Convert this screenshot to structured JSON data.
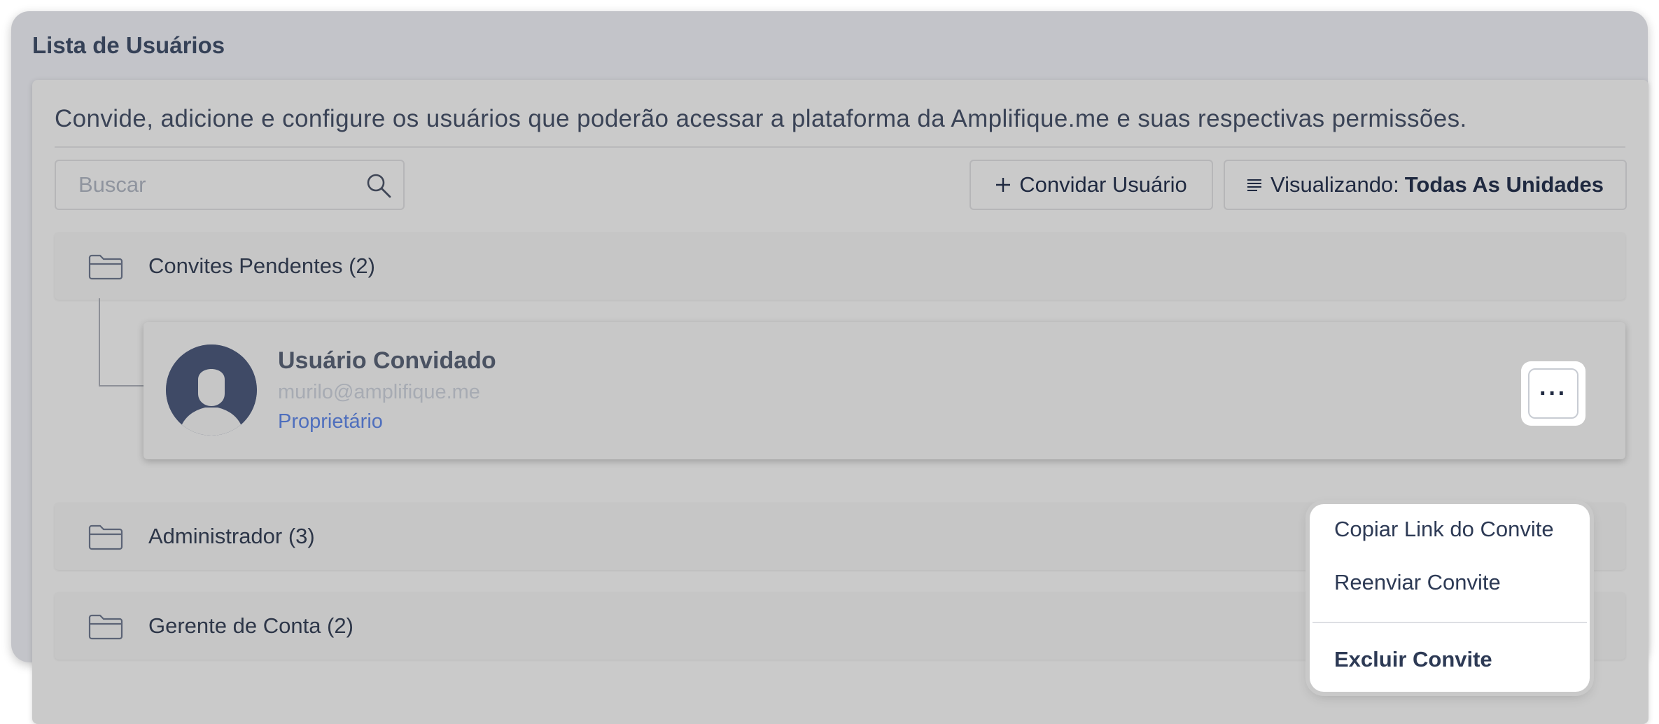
{
  "page": {
    "title": "Lista de Usuários"
  },
  "main": {
    "description": "Convide, adicione e configure os usuários que poderão acessar a plataforma da Amplifique.me e suas respectivas permissões.",
    "search": {
      "placeholder": "Buscar"
    },
    "invite_button": {
      "label": "Convidar Usuário",
      "icon": "plus-icon"
    },
    "view_button": {
      "prefix": "Visualizando:",
      "value": "Todas As Unidades",
      "icon": "list-icon"
    }
  },
  "groups": [
    {
      "label": "Convites Pendentes (2)",
      "icon": "folder-icon"
    },
    {
      "label": "Administrador (3)",
      "icon": "folder-icon"
    },
    {
      "label": "Gerente de Conta (2)",
      "icon": "folder-icon"
    }
  ],
  "pending_user": {
    "name": "Usuário Convidado",
    "email": "murilo@amplifique.me",
    "role": "Proprietário",
    "avatar_icon": "user-avatar-icon",
    "more_label": "···"
  },
  "menu": {
    "items": [
      "Copiar Link do Convite",
      "Reenviar Convite",
      "Excluir Convite"
    ]
  },
  "colors": {
    "accent_link": "#4f6fbd",
    "text_dark": "#1f2940",
    "avatar_bg": "#3f4a66"
  }
}
